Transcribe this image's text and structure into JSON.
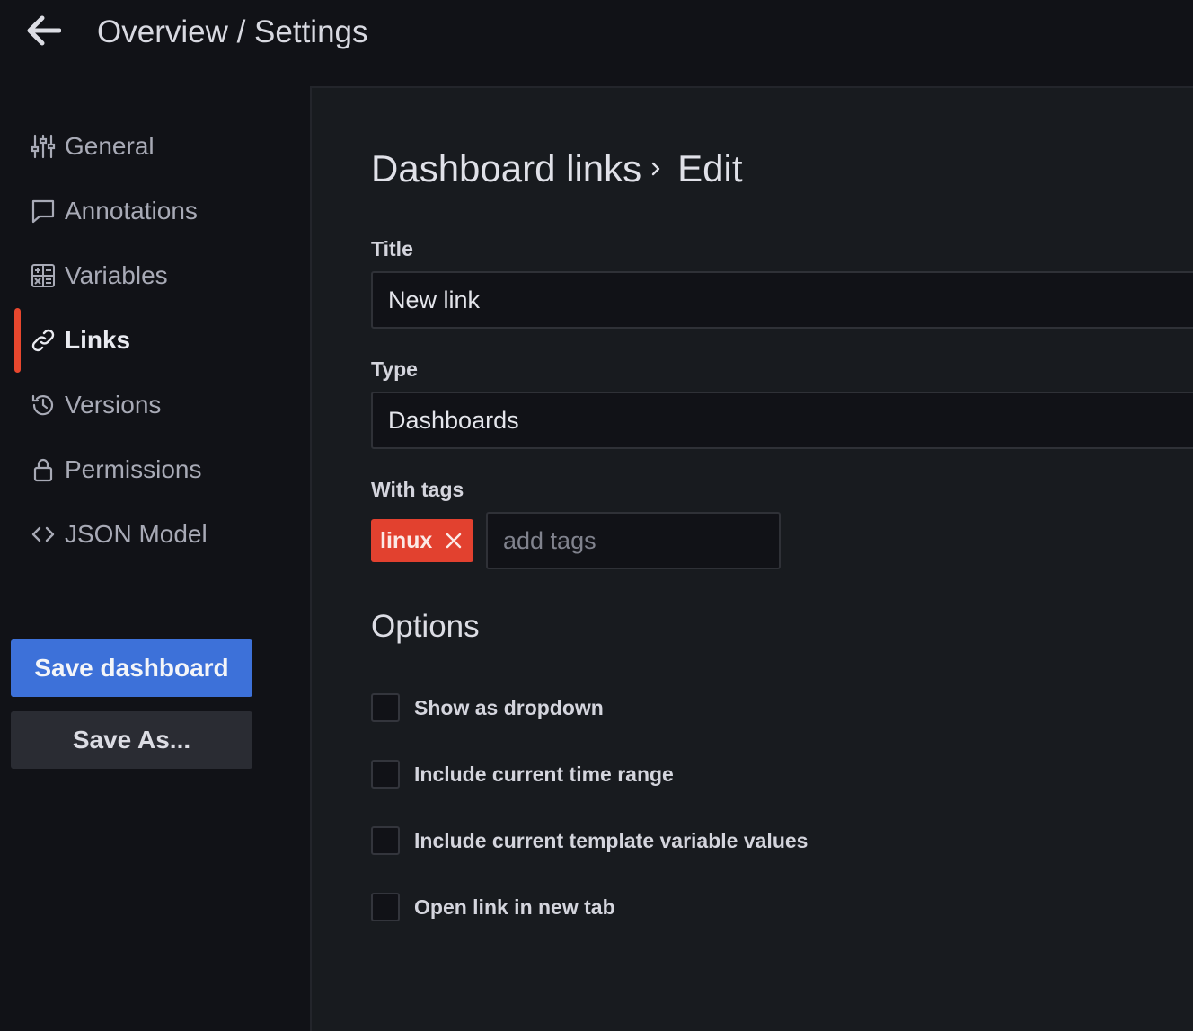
{
  "header": {
    "back_icon": "arrow-left-icon",
    "title": "Overview / Settings"
  },
  "sidebar": {
    "items": [
      {
        "label": "General",
        "icon": "sliders-icon",
        "active": false
      },
      {
        "label": "Annotations",
        "icon": "comment-icon",
        "active": false
      },
      {
        "label": "Variables",
        "icon": "calculator-icon",
        "active": false
      },
      {
        "label": "Links",
        "icon": "link-icon",
        "active": true
      },
      {
        "label": "Versions",
        "icon": "history-icon",
        "active": false
      },
      {
        "label": "Permissions",
        "icon": "lock-icon",
        "active": false
      },
      {
        "label": "JSON Model",
        "icon": "code-brackets-icon",
        "active": false
      }
    ],
    "save_label": "Save dashboard",
    "save_as_label": "Save As..."
  },
  "main": {
    "breadcrumb": {
      "parent": "Dashboard links",
      "current": "Edit"
    },
    "title_field": {
      "label": "Title",
      "value": "New link"
    },
    "type_field": {
      "label": "Type",
      "value": "Dashboards"
    },
    "tags_field": {
      "label": "With tags",
      "tags": [
        "linux"
      ],
      "placeholder": "add tags"
    },
    "options": {
      "title": "Options",
      "items": [
        {
          "label": "Show as dropdown",
          "checked": false
        },
        {
          "label": "Include current time range",
          "checked": false
        },
        {
          "label": "Include current template variable values",
          "checked": false
        },
        {
          "label": "Open link in new tab",
          "checked": false
        }
      ]
    }
  },
  "colors": {
    "background": "#111217",
    "panel": "#181b1f",
    "accent_active": "#e8472e",
    "primary_button": "#3d71d9",
    "tag": "#e2412f"
  }
}
